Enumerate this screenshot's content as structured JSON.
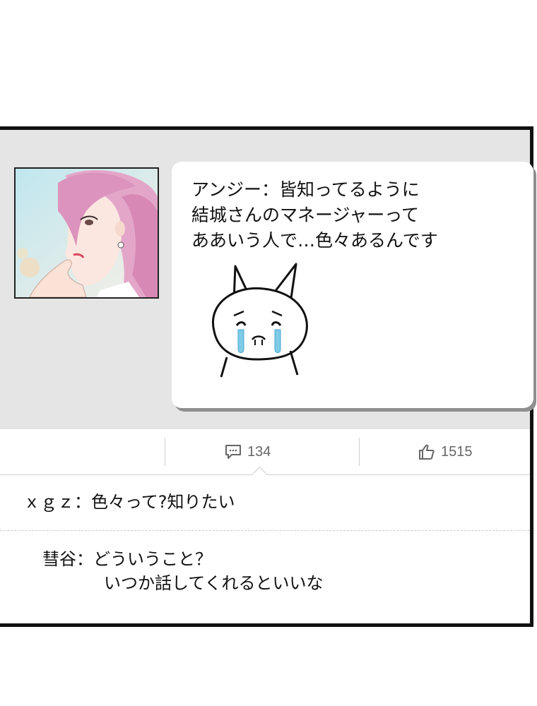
{
  "post": {
    "author_avatar": "pink-haired-woman-avatar",
    "message_lines": [
      "アンジー：皆知ってるように",
      "結城さんのマネージャーって",
      "ああいう人で…色々あるんです"
    ],
    "sticker": "crying-cat-sticker"
  },
  "stats": {
    "comments_count": "134",
    "likes_count": "1515",
    "comment_icon": "comment-icon",
    "like_icon": "thumbs-up-icon"
  },
  "comments": [
    {
      "text": "ｘｇｚ：色々って?知りたい"
    },
    {
      "line1": "彗谷：どういうこと？",
      "line2": "いつか話してくれるといいな"
    }
  ],
  "colors": {
    "panel_bg": "#e5e5e5",
    "tear": "#7ecbe8",
    "border": "#111111"
  }
}
